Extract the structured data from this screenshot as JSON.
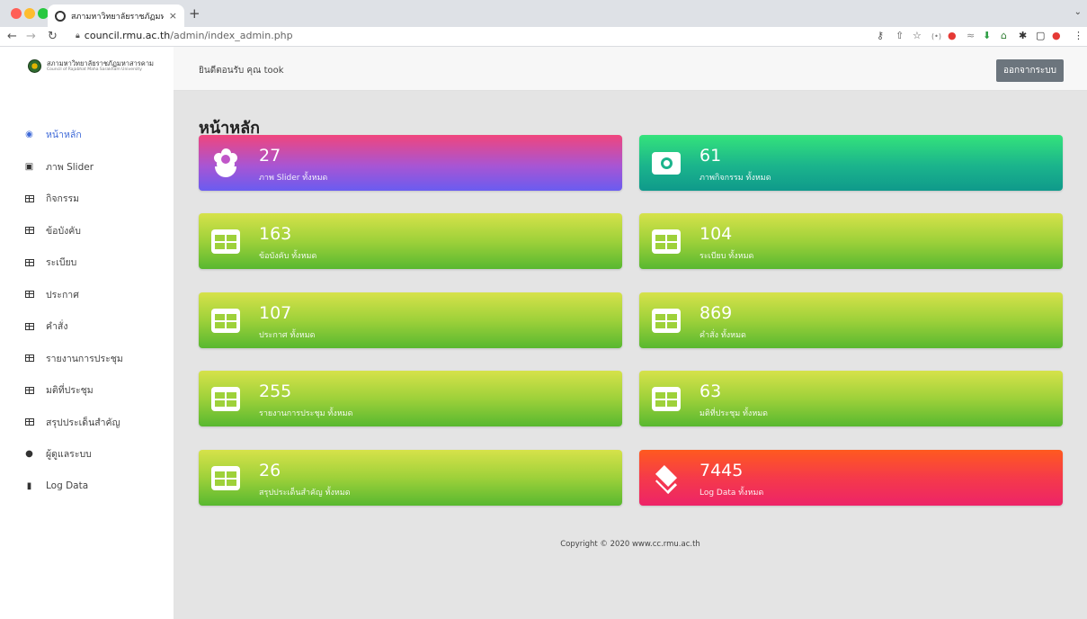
{
  "browser": {
    "tab_title": "สภามหาวิทยาลัยราชภัฏมหาสารคาม",
    "tab_close": "×",
    "new_tab": "+",
    "url_domain": "council.rmu.ac.th",
    "url_path": "/admin/index_admin.php"
  },
  "brand": {
    "name": "สภามหาวิทยาลัยราชภัฏมหาสารคาม",
    "subtitle": "Council of Rajabhat Maha Sarakham University"
  },
  "header": {
    "welcome": "ยินดีตอนรับ คุณ took",
    "logout_label": "ออกจากระบบ"
  },
  "sidebar": {
    "items": [
      {
        "label": "หน้าหลัก",
        "icon": "dashboard-icon",
        "active": true
      },
      {
        "label": "ภาพ Slider",
        "icon": "image-icon"
      },
      {
        "label": "กิจกรรม",
        "icon": "table-icon"
      },
      {
        "label": "ข้อบังคับ",
        "icon": "table-icon"
      },
      {
        "label": "ระเบียบ",
        "icon": "table-icon"
      },
      {
        "label": "ประกาศ",
        "icon": "table-icon"
      },
      {
        "label": "คำสั่ง",
        "icon": "table-icon"
      },
      {
        "label": "รายงานการประชุม",
        "icon": "table-icon"
      },
      {
        "label": "มติที่ประชุม",
        "icon": "table-icon"
      },
      {
        "label": "สรุปประเด็นสำคัญ",
        "icon": "table-icon"
      },
      {
        "label": "ผู้ดูแลระบบ",
        "icon": "user-icon"
      },
      {
        "label": "Log Data",
        "icon": "copy-icon"
      }
    ]
  },
  "main": {
    "title": "หน้าหลัก",
    "cards": [
      {
        "count": "27",
        "label": "ภาพ Slider ทั้งหมด",
        "icon": "flower-icon",
        "color": "#a855d3"
      },
      {
        "count": "61",
        "label": "ภาพกิจกรรม ทั้งหมด",
        "icon": "camera-icon",
        "color": "#1bb48c"
      },
      {
        "count": "163",
        "label": "ข้อบังคับ ทั้งหมด",
        "icon": "table-icon",
        "color": "#9ed13a"
      },
      {
        "count": "104",
        "label": "ระเบียบ ทั้งหมด",
        "icon": "table-icon",
        "color": "#9ed13a"
      },
      {
        "count": "107",
        "label": "ประกาศ ทั้งหมด",
        "icon": "table-icon",
        "color": "#9ed13a"
      },
      {
        "count": "869",
        "label": "คำสั่ง ทั้งหมด",
        "icon": "table-icon",
        "color": "#9ed13a"
      },
      {
        "count": "255",
        "label": "รายงานการประชุม ทั้งหมด",
        "icon": "table-icon",
        "color": "#9ed13a"
      },
      {
        "count": "63",
        "label": "มติที่ประชุม ทั้งหมด",
        "icon": "table-icon",
        "color": "#9ed13a"
      },
      {
        "count": "26",
        "label": "สรุปประเด็นสำคัญ ทั้งหมด",
        "icon": "table-icon",
        "color": "#9ed13a"
      },
      {
        "count": "7445",
        "label": "Log Data ทั้งหมด",
        "icon": "layers-icon",
        "color": "#f53a4a"
      }
    ]
  },
  "footer": {
    "copyright": "Copyright © 2020 www.cc.rmu.ac.th"
  }
}
